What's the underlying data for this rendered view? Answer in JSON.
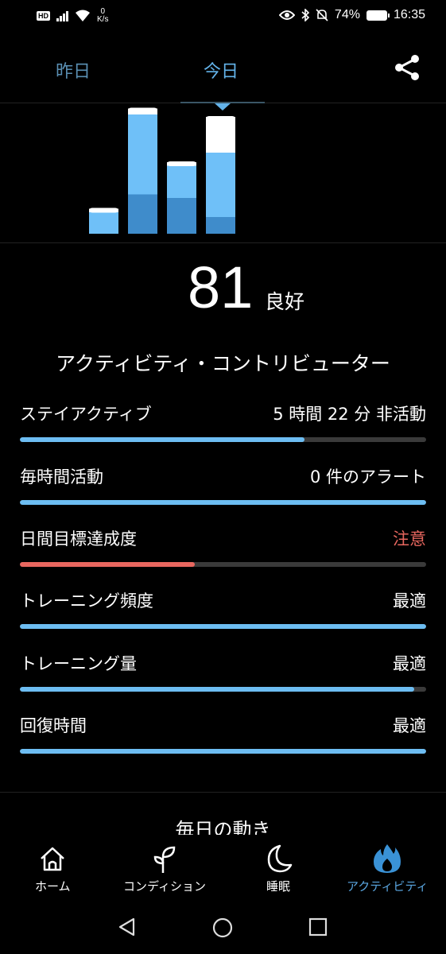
{
  "status_bar": {
    "hd": "HD",
    "net_speed_value": "0",
    "net_speed_unit": "K/s",
    "battery": "74%",
    "time": "16:35"
  },
  "tabs": {
    "yesterday": "昨日",
    "today": "今日"
  },
  "chart_data": {
    "type": "bar",
    "categories": [
      "",
      "",
      "",
      ""
    ],
    "series": [
      {
        "values": [
          0,
          0.33,
          0.3,
          0.14
        ]
      },
      {
        "values": [
          0.18,
          0.67,
          0.27,
          0.54
        ]
      },
      {
        "values": [
          0.03,
          0.05,
          0.03,
          0.3
        ]
      }
    ],
    "colors": [
      "#3f8ccb",
      "#6fc0f8",
      "#ffffff"
    ]
  },
  "score": {
    "value": "81",
    "label": "良好"
  },
  "section_title": "アクティビティ・コントリビューター",
  "metrics": [
    {
      "label": "ステイアクティブ",
      "value": "5 時間 22 分 非活動",
      "progress": 0.7,
      "status": "normal"
    },
    {
      "label": "毎時間活動",
      "value": "0 件のアラート",
      "progress": 1.0,
      "status": "normal"
    },
    {
      "label": "日間目標達成度",
      "value": "注意",
      "progress": 0.43,
      "status": "warn"
    },
    {
      "label": "トレーニング頻度",
      "value": "最適",
      "progress": 1.0,
      "status": "normal"
    },
    {
      "label": "トレーニング量",
      "value": "最適",
      "progress": 0.97,
      "status": "normal"
    },
    {
      "label": "回復時間",
      "value": "最適",
      "progress": 1.0,
      "status": "normal"
    }
  ],
  "daily_title": "毎日の動き",
  "bottom_nav": {
    "home": "ホーム",
    "condition": "コンディション",
    "sleep": "睡眠",
    "activity": "アクティビティ"
  },
  "colors": {
    "accent": "#63b3ea",
    "warn": "#e8675f",
    "bar_dark": "#3f8ccb",
    "bar_light": "#6fc0f8"
  }
}
